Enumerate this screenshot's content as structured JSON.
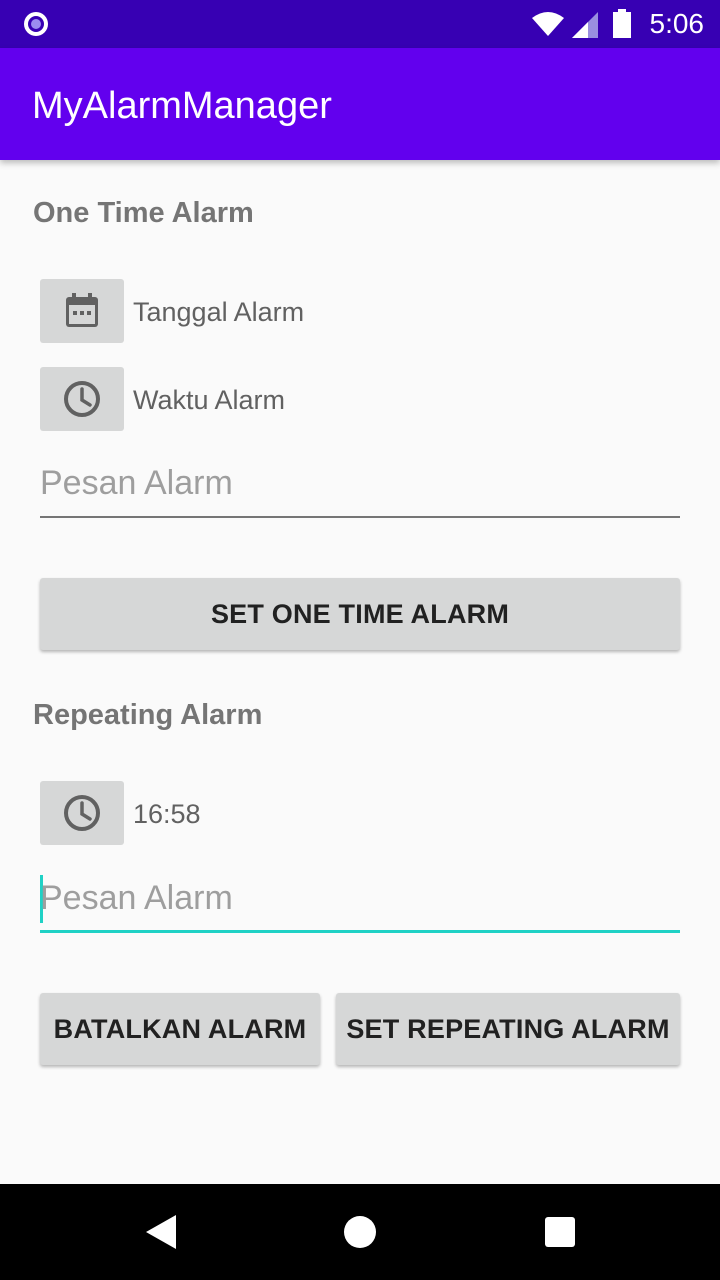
{
  "status_bar": {
    "time": "5:06"
  },
  "app_bar": {
    "title": "MyAlarmManager"
  },
  "one_time": {
    "title": "One Time Alarm",
    "date_label": "Tanggal Alarm",
    "time_label": "Waktu Alarm",
    "message_placeholder": "Pesan Alarm",
    "set_button": "SET ONE TIME ALARM"
  },
  "repeating": {
    "title": "Repeating Alarm",
    "time_label": "16:58",
    "message_placeholder": "Pesan Alarm",
    "cancel_button": "BATALKAN ALARM",
    "set_button": "SET REPEATING ALARM"
  },
  "icons": {
    "status": [
      "notification-dot-icon",
      "wifi-icon",
      "signal-icon",
      "battery-icon"
    ],
    "rows": [
      "calendar-icon",
      "clock-icon"
    ],
    "nav": [
      "back-icon",
      "home-icon",
      "recents-icon"
    ]
  },
  "colors": {
    "status_bar": "#3700b3",
    "app_bar": "#6200ee",
    "accent": "#1fd1c5",
    "button": "#d6d7d7"
  }
}
